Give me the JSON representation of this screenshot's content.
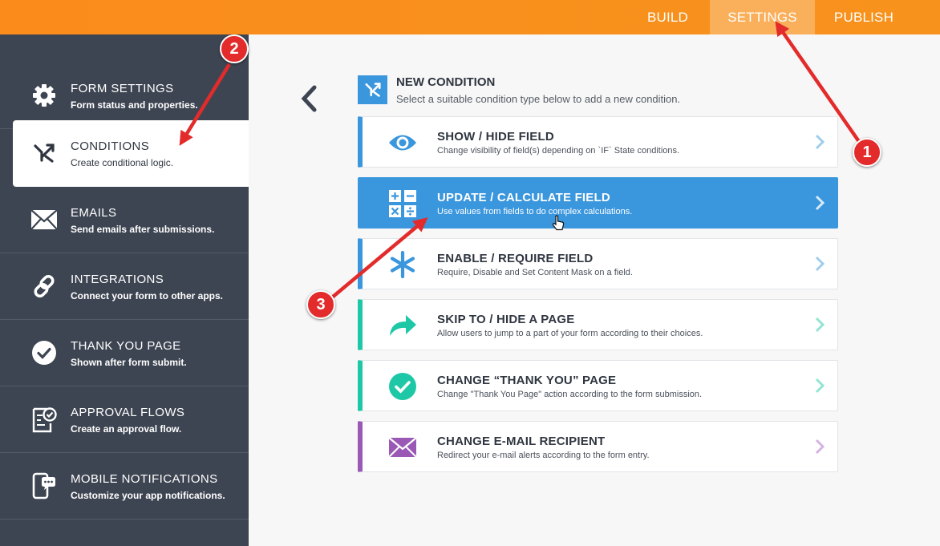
{
  "topnav": {
    "tabs": [
      {
        "label": "BUILD"
      },
      {
        "label": "SETTINGS"
      },
      {
        "label": "PUBLISH"
      }
    ],
    "active_index": 1
  },
  "sidebar": {
    "items": [
      {
        "title": "FORM SETTINGS",
        "subtitle": "Form status and properties.",
        "icon": "gear-icon"
      },
      {
        "title": "CONDITIONS",
        "subtitle": "Create conditional logic.",
        "icon": "conditions-icon"
      },
      {
        "title": "EMAILS",
        "subtitle": "Send emails after submissions.",
        "icon": "envelope-icon"
      },
      {
        "title": "INTEGRATIONS",
        "subtitle": "Connect your form to other apps.",
        "icon": "link-icon"
      },
      {
        "title": "THANK YOU PAGE",
        "subtitle": "Shown after form submit.",
        "icon": "check-circle-icon"
      },
      {
        "title": "APPROVAL FLOWS",
        "subtitle": "Create an approval flow.",
        "icon": "approval-icon"
      },
      {
        "title": "MOBILE NOTIFICATIONS",
        "subtitle": "Customize your app notifications.",
        "icon": "mobile-chat-icon"
      }
    ],
    "active_index": 1
  },
  "main": {
    "header": {
      "title": "NEW CONDITION",
      "subtitle": "Select a suitable condition type below to add a new condition."
    },
    "conditions": [
      {
        "title": "SHOW / HIDE FIELD",
        "subtitle": "Change visibility of field(s) depending on `IF` State conditions.",
        "icon": "eye-icon",
        "color": "#3a96dd"
      },
      {
        "title": "UPDATE / CALCULATE FIELD",
        "subtitle": "Use values from fields to do complex calculations.",
        "icon": "calculator-icon",
        "color": "#3a96dd"
      },
      {
        "title": "ENABLE / REQUIRE FIELD",
        "subtitle": "Require, Disable and Set Content Mask on a field.",
        "icon": "asterisk-icon",
        "color": "#3a96dd"
      },
      {
        "title": "SKIP TO / HIDE A PAGE",
        "subtitle": "Allow users to jump to a part of your form according to their choices.",
        "icon": "skip-arrow-icon",
        "color": "#1ec8a6"
      },
      {
        "title": "CHANGE “THANK YOU” PAGE",
        "subtitle": "Change \"Thank You Page\" action according to the form submission.",
        "icon": "check-circle-icon",
        "color": "#1ec8a6"
      },
      {
        "title": "CHANGE E-MAIL RECIPIENT",
        "subtitle": "Redirect your e-mail alerts according to the form entry.",
        "icon": "envelope-icon",
        "color": "#9b59b6"
      }
    ],
    "active_index": 1
  },
  "annotations": {
    "badges": [
      "1",
      "2",
      "3"
    ],
    "color": "#e32b2b"
  }
}
